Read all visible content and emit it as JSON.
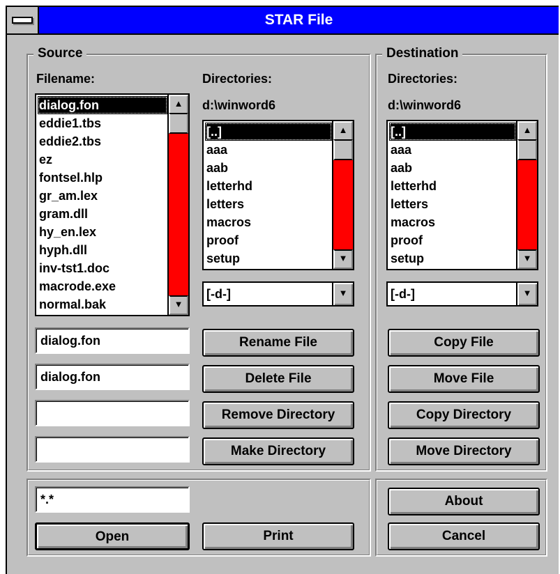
{
  "window": {
    "title": "STAR File"
  },
  "source": {
    "legend": "Source",
    "filename_label": "Filename:",
    "files": [
      "dialog.fon",
      "eddie1.tbs",
      "eddie2.tbs",
      "ez",
      "fontsel.hlp",
      "gr_am.lex",
      "gram.dll",
      "hy_en.lex",
      "hyph.dll",
      "inv-tst1.doc",
      "macrode.exe",
      "normal.bak"
    ],
    "selected_file": "dialog.fon",
    "directories_label": "Directories:",
    "current_dir": "d:\\winword6",
    "dirs": [
      "[..]",
      "aaa",
      "aab",
      "letterhd",
      "letters",
      "macros",
      "proof",
      "setup"
    ],
    "drive": "[-d-]",
    "field1": "dialog.fon",
    "field2": "dialog.fon",
    "field3": "",
    "field4": "",
    "rename_label": "Rename File",
    "delete_label": "Delete File",
    "remove_dir_label": "Remove Directory",
    "make_dir_label": "Make Directory"
  },
  "destination": {
    "legend": "Destination",
    "directories_label": "Directories:",
    "current_dir": "d:\\winword6",
    "dirs": [
      "[..]",
      "aaa",
      "aab",
      "letterhd",
      "letters",
      "macros",
      "proof",
      "setup"
    ],
    "drive": "[-d-]",
    "copy_file_label": "Copy File",
    "move_file_label": "Move File",
    "copy_dir_label": "Copy Directory",
    "move_dir_label": "Move Directory"
  },
  "bottom": {
    "pattern": "*.*",
    "open_label": "Open",
    "print_label": "Print",
    "about_label": "About",
    "cancel_label": "Cancel"
  },
  "colors": {
    "titlebar": "#0000ff",
    "scroll_track": "#ff0000",
    "face": "#c0c0c0"
  },
  "icons": [
    "system-menu-icon",
    "scroll-up-arrow-icon",
    "scroll-down-arrow-icon",
    "dropdown-arrow-icon"
  ]
}
